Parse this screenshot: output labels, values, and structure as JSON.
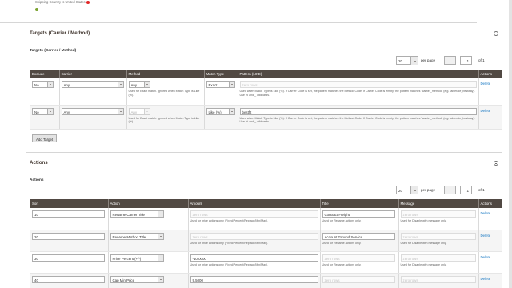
{
  "top": {
    "text": "Shipping Country is United States"
  },
  "targets": {
    "section_title": "Targets (Carrier / Method)",
    "subheading": "Targets (Carrier / Method)",
    "pager": {
      "per_page_value": "20",
      "per_page_label": "per page",
      "page": "1",
      "of_label": "of 1"
    },
    "columns": [
      "Exclude",
      "Carrier",
      "Method",
      "Match Type",
      "Pattern (LIKE)",
      "Actions"
    ],
    "rows": [
      {
        "exclude": "No",
        "carrier": "Any",
        "method": "Any",
        "method_note": "Used for Exact match. Ignored when Match Type is Like (%).",
        "match_type": "Exact",
        "pattern": "",
        "pattern_placeholder": "zero rows",
        "pattern_note": "Used when Match Type is Like (%). If Carrier Code is set, the pattern matches the Method Code. If Carrier Code is empty, the pattern matches \"carrier_method\" (e.g. tablerate_bestway). Use % and _ wildcards.",
        "action": "Delete"
      },
      {
        "exclude": "No",
        "carrier": "Any",
        "method": "Any",
        "method_note": "Used for Exact match. Ignored when Match Type is Like (%).",
        "match_type": "Like (%)",
        "pattern": "bestfit",
        "pattern_note": "Used when Match Type is Like (%). If Carrier Code is set, the pattern matches the Method Code. If Carrier Code is empty, the pattern matches \"carrier_method\" (e.g. tablerate_bestway). Use % and _ wildcards.",
        "action": "Delete"
      }
    ],
    "add_button": "Add Target"
  },
  "actions": {
    "section_title": "Actions",
    "subheading": "Actions",
    "pager": {
      "per_page_value": "20",
      "per_page_label": "per page",
      "page": "1",
      "of_label": "of 1"
    },
    "columns": [
      "Sort",
      "Action",
      "Amount",
      "Title",
      "Message",
      "Actions"
    ],
    "rows": [
      {
        "sort": "10",
        "action": "Rename Carrier Title",
        "amount": "",
        "amount_placeholder": "zero rows",
        "amount_note": "Used for price actions only (Fixed/Percent/Replace/Min/Max).",
        "title": "Contract Freight",
        "title_note": "Used for Rename actions only.",
        "message": "",
        "message_placeholder": "zero rows",
        "message_note": "Used for Disable with message only.",
        "link": "Delete"
      },
      {
        "sort": "20",
        "action": "Rename Method Title",
        "amount": "",
        "amount_placeholder": "zero rows",
        "amount_note": "Used for price actions only (Fixed/Percent/Replace/Min/Max).",
        "title": "Account Ground Service",
        "title_note": "Used for Rename actions only.",
        "message": "",
        "message_placeholder": "zero rows",
        "message_note": "Used for Disable with message only.",
        "link": "Delete"
      },
      {
        "sort": "30",
        "action": "Price Percent (+/-)",
        "amount": "-10.0000",
        "amount_note": "Used for price actions only (Fixed/Percent/Replace/Min/Max).",
        "title": "",
        "title_placeholder": "zero rows",
        "title_note": "Used for Rename actions only.",
        "message": "",
        "message_placeholder": "zero rows",
        "message_note": "Used for Disable with message only.",
        "link": "Delete"
      },
      {
        "sort": "40",
        "action": "Cap Min Price",
        "amount": "9.5000",
        "amount_note": "",
        "title": "",
        "title_placeholder": "zero rows",
        "title_note": "",
        "message": "",
        "message_placeholder": "zero rows",
        "message_note": "",
        "link": "Delete"
      }
    ]
  },
  "colors": {
    "header_bg": "#514943",
    "link": "#1979c3",
    "row_alt": "#f5f5f5",
    "status_ok": "#79a22e",
    "status_error": "#e22626"
  },
  "icons": {
    "collapse": "minus-circle-icon",
    "prev": "chevron-left-icon",
    "next": "chevron-right-icon",
    "dropdown": "chevron-down-icon"
  }
}
